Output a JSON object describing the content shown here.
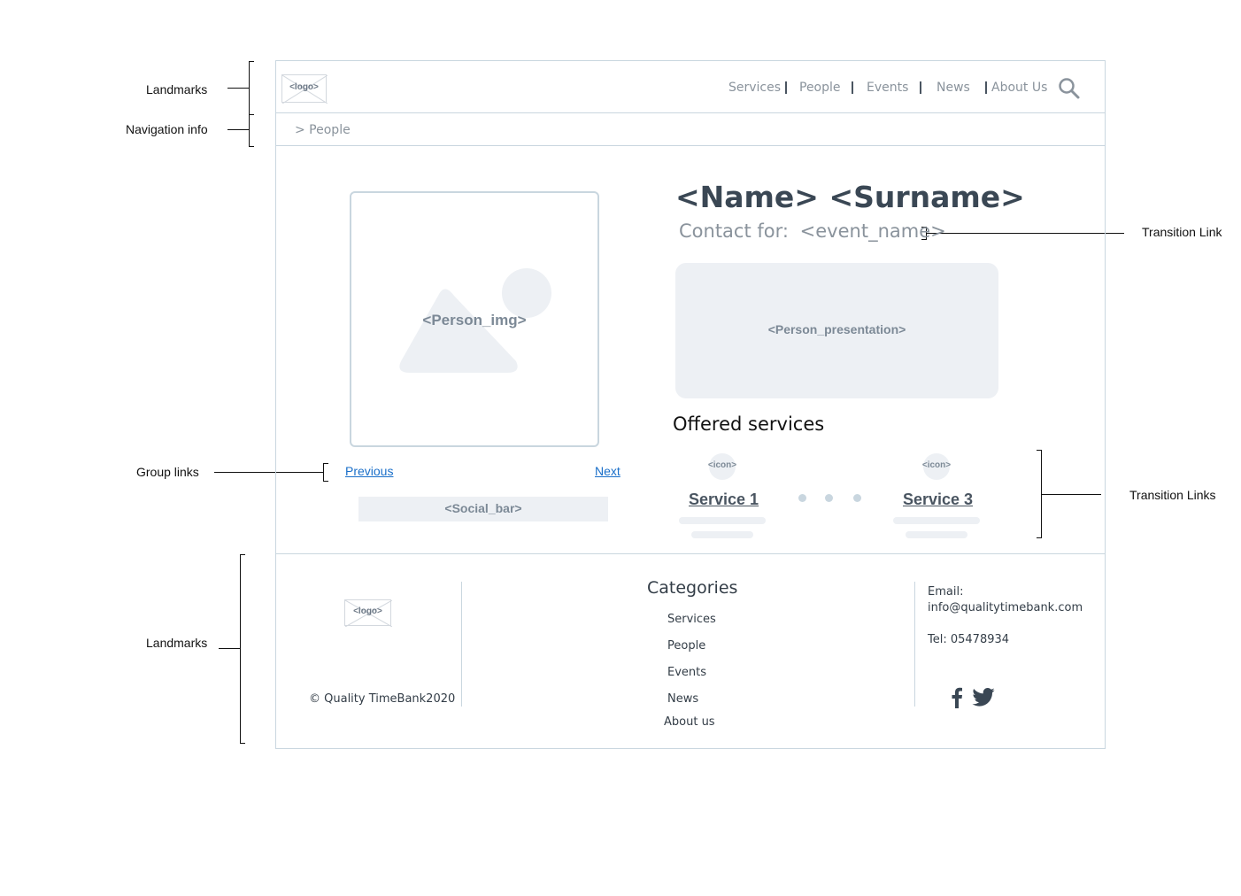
{
  "annotations": {
    "landmarks_top": "Landmarks",
    "navigation_info": "Navigation info",
    "group_links": "Group links",
    "landmarks_bottom": "Landmarks",
    "transition_link": "Transition Link",
    "transition_links": "Transition Links"
  },
  "header": {
    "logo_text": "<logo>",
    "nav": [
      "Services",
      "People",
      "Events",
      "News",
      "About Us"
    ],
    "search_icon": "search-icon"
  },
  "breadcrumb": "> People",
  "person": {
    "image_label": "<Person_img>",
    "name": "<Name> <Surname>",
    "contact_label": "Contact for:",
    "event_name": "<event_name>",
    "presentation_label": "<Person_presentation>"
  },
  "pager": {
    "previous": "Previous",
    "next": "Next"
  },
  "social_bar": "<Social_bar>",
  "services": {
    "title": "Offered services",
    "icon_label": "<icon>",
    "items": [
      "Service 1",
      "Service 3"
    ]
  },
  "footer": {
    "logo_text": "<logo>",
    "copyright": "© Quality TimeBank2020",
    "categories_title": "Categories",
    "categories": [
      "Services",
      "People",
      "Events",
      "News",
      "About us"
    ],
    "email_label": "Email:",
    "email": "info@qualitytimebank.com",
    "tel": "Tel: 05478934",
    "social_icons": [
      "facebook-icon",
      "twitter-icon"
    ]
  },
  "colors": {
    "frame": "#c9d6df",
    "placeholder": "#edf0f4",
    "link": "#1a6fc9",
    "heading": "#3a4754"
  }
}
